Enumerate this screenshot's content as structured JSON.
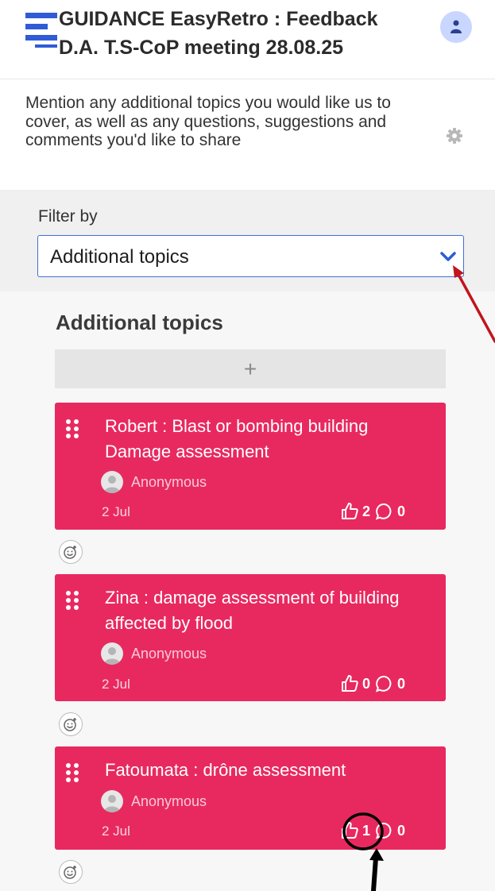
{
  "header": {
    "title_line1": "GUIDANCE EasyRetro : Feedback",
    "title_line2": "D.A. T.S-CoP meeting 28.08.25"
  },
  "description": "Mention any additional topics you would like us to cover, as well as any questions, suggestions and comments you'd like to share",
  "filter": {
    "label": "Filter by",
    "selected": "Additional topics"
  },
  "column": {
    "title": "Additional topics",
    "add_symbol": "+"
  },
  "cards": [
    {
      "text": "Robert : Blast or bombing building Damage assessment",
      "author": "Anonymous",
      "date": "2 Jul",
      "likes": "2",
      "comments": "0"
    },
    {
      "text": "Zina : damage assessment of building affected by flood",
      "author": "Anonymous",
      "date": "2 Jul",
      "likes": "0",
      "comments": "0"
    },
    {
      "text": "Fatoumata : drône assessment",
      "author": "Anonymous",
      "date": "2 Jul",
      "likes": "1",
      "comments": "0"
    }
  ],
  "colors": {
    "card": "#e8295f",
    "accent": "#3f6fd8",
    "logo": "#2f5bd6",
    "annotation_red": "#c0161c",
    "annotation_black": "#000000"
  },
  "icons": [
    "logo-icon",
    "user-icon",
    "gear-icon",
    "chevron-down-icon",
    "drag-handle-icon",
    "thumbs-up-icon",
    "comment-icon",
    "add-reaction-icon"
  ]
}
